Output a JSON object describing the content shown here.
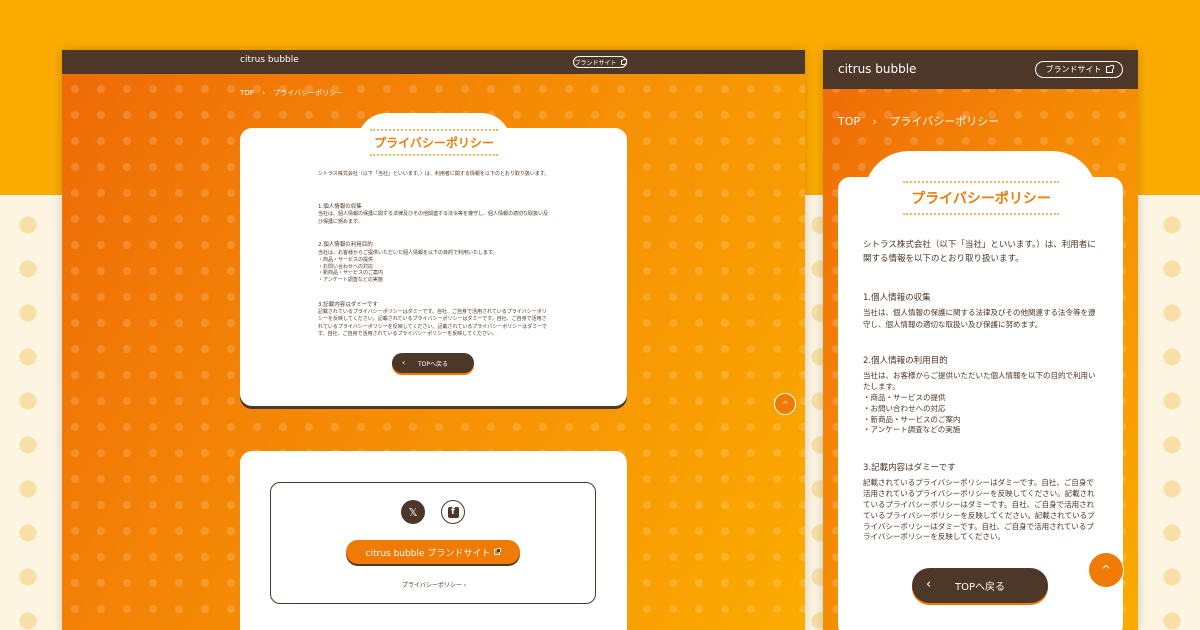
{
  "brand": {
    "logo": "citrus bubble",
    "site_button": "ブランドサイト"
  },
  "breadcrumb": {
    "home": "TOP",
    "separator": "›",
    "current": "プライバシーポリシー"
  },
  "policy": {
    "title": "プライバシーポリシー",
    "intro": "シトラス株式会社（以下「当社」といいます。）は、利用者に関する情報を以下のとおり取り扱います。",
    "sections": [
      {
        "heading": "1.個人情報の収集",
        "body": "当社は、個人情報の保護に関する法律及びその他関連する法令等を遵守し、個人情報の適切な取扱い及び保護に努めます。"
      },
      {
        "heading": "2.個人情報の利用目的",
        "body": "当社は、お客様からご提供いただいた個人情報を以下の目的で利用いたします。\n・商品・サービスの提供\n・お問い合わせへの対応\n・新商品・サービスのご案内\n・アンケート調査などの実施"
      },
      {
        "heading": "3.記載内容はダミーです",
        "body": "記載されているプライバシーポリシーはダミーです。自社、ご自身で活用されているプライバシーポリシーを反映してください。記載されているプライバシーポリシーはダミーです。自社、ご自身で活用されているプライバシーポリシーを反映してください。記載されているプライバシーポリシーはダミーです。自社、ご自身で活用されているプライバシーポリシーを反映してください。"
      }
    ],
    "back_button": "TOPへ戻る"
  },
  "footer": {
    "brand_button": "citrus bubble ブランドサイト",
    "privacy_link": "プライバシーポリシー ›",
    "x_icon": "𝕏",
    "facebook_icon": "f"
  },
  "scroll_top_icon": "^",
  "colors": {
    "header": "#4d3728",
    "accent": "#ef7b05",
    "page_bg": "#fbab00"
  }
}
